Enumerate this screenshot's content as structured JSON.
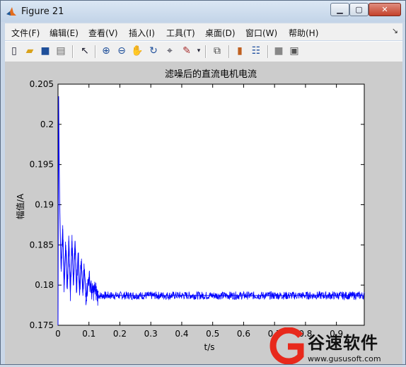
{
  "window": {
    "title": "Figure 21",
    "icon": "matlab-icon",
    "controls": [
      "minimize-icon",
      "maximize-icon",
      "close-icon"
    ]
  },
  "menu": {
    "items": [
      "文件(F)",
      "编辑(E)",
      "查看(V)",
      "插入(I)",
      "工具(T)",
      "桌面(D)",
      "窗口(W)",
      "帮助(H)"
    ]
  },
  "toolbar": {
    "icons": [
      "new-figure-icon",
      "open-file-icon",
      "save-icon",
      "print-icon",
      "pointer-icon",
      "zoom-in-icon",
      "zoom-out-icon",
      "pan-icon",
      "rotate-3d-icon",
      "data-cursor-icon",
      "brush-icon",
      "link-plot-icon",
      "colorbar-icon",
      "legend-icon",
      "hide-plot-tools-icon",
      "show-plot-tools-icon"
    ]
  },
  "chart_data": {
    "type": "line",
    "title": "滤噪后的直流电机电流",
    "xlabel": "t/s",
    "ylabel": "幅值/A",
    "xlim": [
      0,
      0.99
    ],
    "ylim": [
      0.175,
      0.205
    ],
    "x_ticks": [
      "0",
      "0.1",
      "0.2",
      "0.3",
      "0.4",
      "0.5",
      "0.6",
      "0.7",
      "0.8",
      "0.9"
    ],
    "y_ticks": [
      "0.175",
      "0.18",
      "0.185",
      "0.19",
      "0.195",
      "0.2",
      "0.205"
    ],
    "grid": false,
    "series": [
      {
        "color": "#0000ff",
        "x": [
          0,
          0.002,
          0.004,
          0.006,
          0.008,
          0.01,
          0.015,
          0.02,
          0.025,
          0.03,
          0.035,
          0.04,
          0.045,
          0.05,
          0.055,
          0.06,
          0.065,
          0.07,
          0.075,
          0.08,
          0.085,
          0.09,
          0.1,
          0.11,
          0.12,
          0.13,
          0.15,
          0.2,
          0.3,
          0.4,
          0.5,
          0.6,
          0.7,
          0.8,
          0.9,
          0.99
        ],
        "y": [
          0.175,
          0.2035,
          0.195,
          0.189,
          0.185,
          0.182,
          0.187,
          0.18,
          0.185,
          0.1795,
          0.1855,
          0.179,
          0.1855,
          0.18,
          0.1855,
          0.1795,
          0.184,
          0.1795,
          0.183,
          0.179,
          0.182,
          0.1785,
          0.181,
          0.179,
          0.1795,
          0.1785,
          0.1787,
          0.1787,
          0.1787,
          0.1787,
          0.1787,
          0.1787,
          0.1787,
          0.1787,
          0.1787,
          0.1787
        ],
        "steady_state": 0.1787,
        "noise_band": [
          0.1782,
          0.1792
        ]
      }
    ]
  },
  "watermark": {
    "title": "谷速软件",
    "url": "www.gususoft.com",
    "logo": "gusu-logo-icon"
  }
}
